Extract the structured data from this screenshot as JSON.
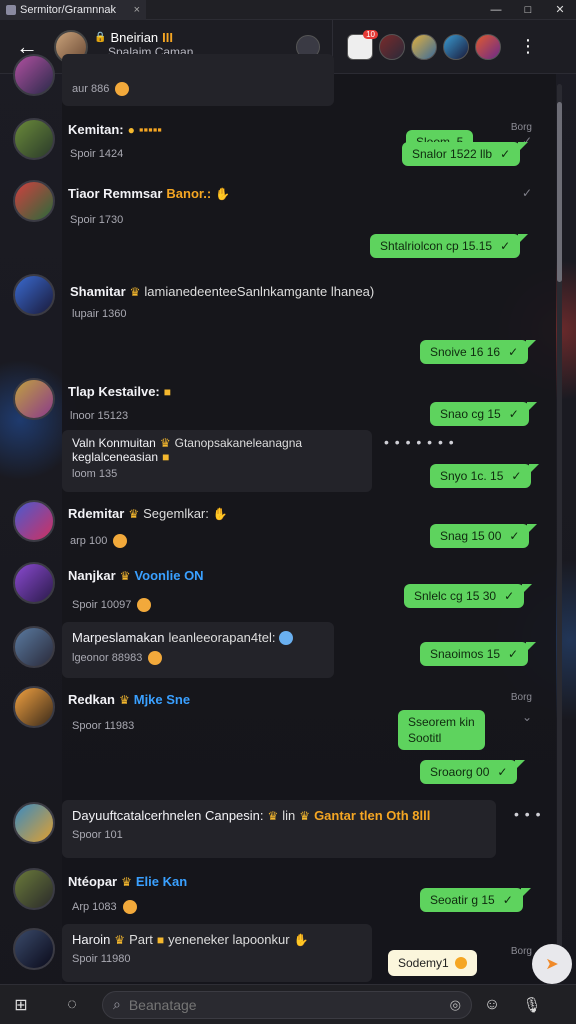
{
  "window": {
    "tab_title": "Sermitor/Gramnnak",
    "tab_close": "×",
    "minimize": "—",
    "maximize": "□",
    "close": "✕"
  },
  "header": {
    "back_glyph": "←",
    "title": "Bneirian",
    "title_badge": "III",
    "subtitle": "Spalaim Caman",
    "menu_glyph": "⋮"
  },
  "messages": [
    {
      "name": "",
      "sub": "aur 886",
      "reply": "Sloom .5"
    },
    {
      "name": "Kemitan:",
      "extra": "▪▪▪▪▪",
      "sub": "Spoir 1424",
      "meta": "Borg",
      "reply": "Snalor 1522 llb"
    },
    {
      "name": "Tiaor Remmsar",
      "extra": "Banor.:",
      "sub": "Spoir 1730",
      "reply": "Shtalriolcon cp 15.15"
    },
    {
      "name": "Shamitar",
      "extra": "lamianedeenteeSanlnkamgante lhanea)",
      "sub": "lupair 1360",
      "reply": "Snoive 16 16"
    },
    {
      "name": "Tlap Kestailve:",
      "extra": "",
      "sub": "lnoor 15123",
      "reply": "Snao cg 15"
    },
    {
      "name": "Valn Konmuitan",
      "extra": "Gtanopsakaneleanagna",
      "extra2": "keglalceneasian",
      "sub": "loom 135",
      "reply": "Snyo 1c. 15",
      "dots": "• • • • • • •"
    },
    {
      "name": "Rdemitar",
      "extra": "Segemlkar:",
      "sub": "arp 100",
      "reply": "Snag 15 00"
    },
    {
      "name": "Nanjkar",
      "extra": "Voonlie ON",
      "sub": "Spoir 10097",
      "reply": "Snlelc cg 15 30"
    },
    {
      "name": "Marpeslamakan",
      "extra": "leanleeorapan4tel:",
      "sub": "lgeonor 88983",
      "reply": "Snaoimos 15"
    },
    {
      "name": "Redkan",
      "extra": "Mjke Sne",
      "sub": "Spoor 11983",
      "meta": "Borg",
      "reply_a": "Sseorem kin",
      "reply_a2": "Sootitl",
      "reply": "Sroaorg 00"
    },
    {
      "name": "Dayuuftcatalcerhnelen Canpesin:",
      "extra": "lin",
      "extra2": "Gantar tlen Oth 8lll",
      "sub": "Spoor 101",
      "dots": "• • •"
    },
    {
      "name": "Ntéopar",
      "extra": "Elie Kan",
      "sub": "Arp 1083",
      "reply": "Seoatir g 15"
    },
    {
      "name": "Haroin",
      "extra": "Part",
      "extra2": "yeneneker lapoonkur",
      "sub": "Spoir 11980",
      "meta": "Borg"
    }
  ],
  "toast": {
    "text": "Sodemy1"
  },
  "composer": {
    "placeholder": "Beanatage",
    "windows_glyph": "⊞",
    "chat_glyph": "◌",
    "emoji_glyph": "☺",
    "mic_glyph": "🎙"
  },
  "colors": {
    "bubble_green": "#5ed35e",
    "panel": "#16161b",
    "card": "#232329",
    "accent_orange": "#f5a623",
    "accent_blue": "#3aa0ff"
  }
}
